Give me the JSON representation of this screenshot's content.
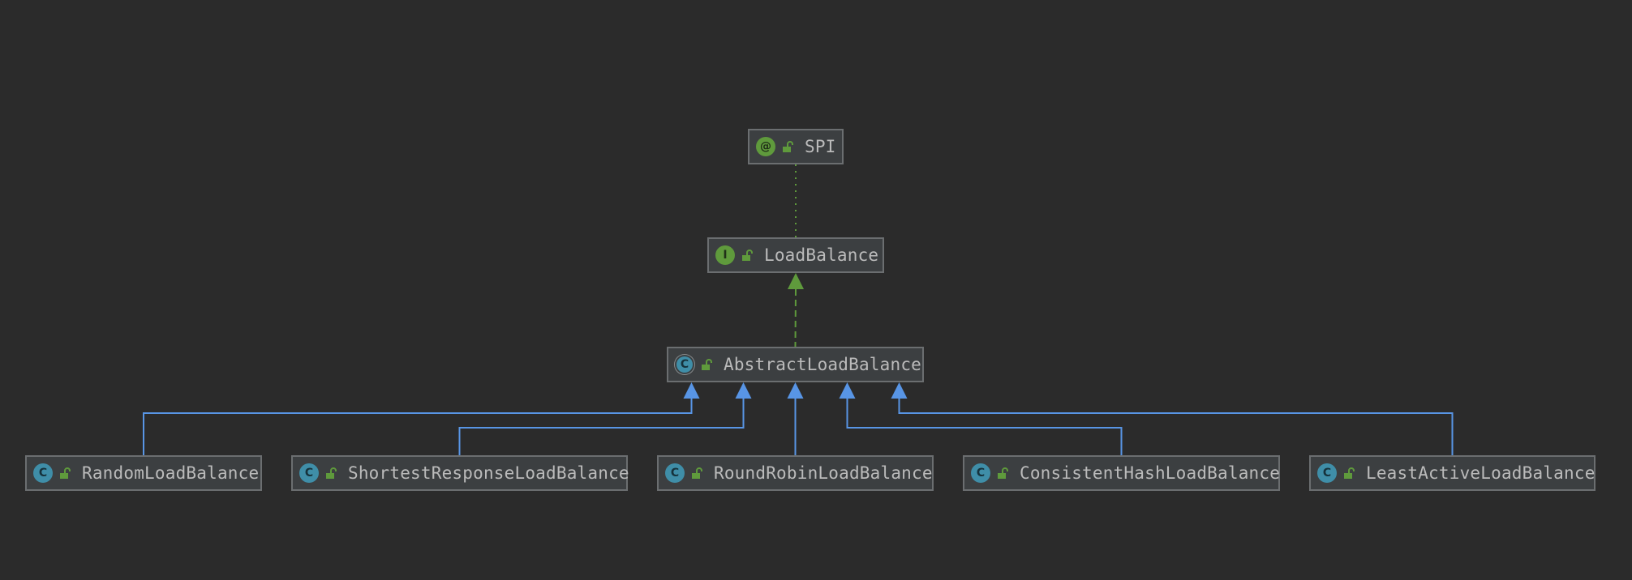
{
  "diagram": {
    "nodes": [
      {
        "id": "spi",
        "label": "SPI",
        "kind": "annotation",
        "kind_glyph": "@",
        "kind_icon": "annotation-icon"
      },
      {
        "id": "loadbalance",
        "label": "LoadBalance",
        "kind": "interface",
        "kind_glyph": "I",
        "kind_icon": "interface-icon"
      },
      {
        "id": "abstractloadbalance",
        "label": "AbstractLoadBalance",
        "kind": "abstract-class",
        "kind_glyph": "C",
        "kind_icon": "abstract-class-icon"
      },
      {
        "id": "randomloadbalance",
        "label": "RandomLoadBalance",
        "kind": "class",
        "kind_glyph": "C",
        "kind_icon": "class-icon"
      },
      {
        "id": "shortestresponseloadbalance",
        "label": "ShortestResponseLoadBalance",
        "kind": "class",
        "kind_glyph": "C",
        "kind_icon": "class-icon"
      },
      {
        "id": "roundrobinloadbalance",
        "label": "RoundRobinLoadBalance",
        "kind": "class",
        "kind_glyph": "C",
        "kind_icon": "class-icon"
      },
      {
        "id": "consistenthashloadbalance",
        "label": "ConsistentHashLoadBalance",
        "kind": "class",
        "kind_glyph": "C",
        "kind_icon": "class-icon"
      },
      {
        "id": "leastactiveloadbalance",
        "label": "LeastActiveLoadBalance",
        "kind": "class",
        "kind_glyph": "C",
        "kind_icon": "class-icon"
      }
    ],
    "edges": [
      {
        "from": "loadbalance",
        "to": "spi",
        "type": "annotated-by"
      },
      {
        "from": "abstractloadbalance",
        "to": "loadbalance",
        "type": "implements"
      },
      {
        "from": "randomloadbalance",
        "to": "abstractloadbalance",
        "type": "extends"
      },
      {
        "from": "shortestresponseloadbalance",
        "to": "abstractloadbalance",
        "type": "extends"
      },
      {
        "from": "roundrobinloadbalance",
        "to": "abstractloadbalance",
        "type": "extends"
      },
      {
        "from": "consistenthashloadbalance",
        "to": "abstractloadbalance",
        "type": "extends"
      },
      {
        "from": "leastactiveloadbalance",
        "to": "abstractloadbalance",
        "type": "extends"
      }
    ],
    "colors": {
      "background": "#2b2b2b",
      "node_fill": "#3c3f41",
      "node_border": "#6b6e70",
      "text": "#bbbbbb",
      "extends_edge": "#5895e5",
      "implements_edge": "#5f9a3c",
      "annotation_edge": "#5f9a3c",
      "class_icon": "#3f8ea8",
      "interface_icon": "#5f9a3c",
      "public_lock": "#5f9a3c"
    }
  }
}
